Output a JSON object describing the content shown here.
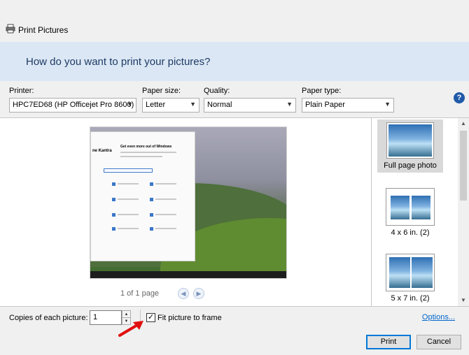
{
  "window": {
    "title": "Print Pictures",
    "close_glyph": "✕"
  },
  "banner": {
    "heading": "How do you want to print your pictures?"
  },
  "options": {
    "printer_label": "Printer:",
    "printer_value": "HPC7ED68 (HP Officejet Pro 8600)",
    "paper_size_label": "Paper size:",
    "paper_size_value": "Letter",
    "quality_label": "Quality:",
    "quality_value": "Normal",
    "paper_type_label": "Paper type:",
    "paper_type_value": "Plain Paper",
    "help_glyph": "?"
  },
  "preview": {
    "page_indicator": "1 of 1 page",
    "prev_glyph": "◀",
    "next_glyph": "▶",
    "screenshot_text": {
      "profile_name": "ne Kantra",
      "card_title": "Get even more out of Windows"
    }
  },
  "layouts": [
    {
      "label": "Full page photo",
      "selected": true
    },
    {
      "label": "4 x 6 in. (2)",
      "selected": false
    },
    {
      "label": "5 x 7 in. (2)",
      "selected": false
    }
  ],
  "copies": {
    "label": "Copies of each picture:",
    "value": "1",
    "fit_label": "Fit picture to frame",
    "fit_checked": true,
    "check_glyph": "✓",
    "options_link": "Options..."
  },
  "buttons": {
    "print": "Print",
    "cancel": "Cancel"
  },
  "colors": {
    "banner_bg": "#dbe7f4",
    "heading": "#1e3b66",
    "link": "#0066cc",
    "annotation_arrow": "#e01010"
  }
}
